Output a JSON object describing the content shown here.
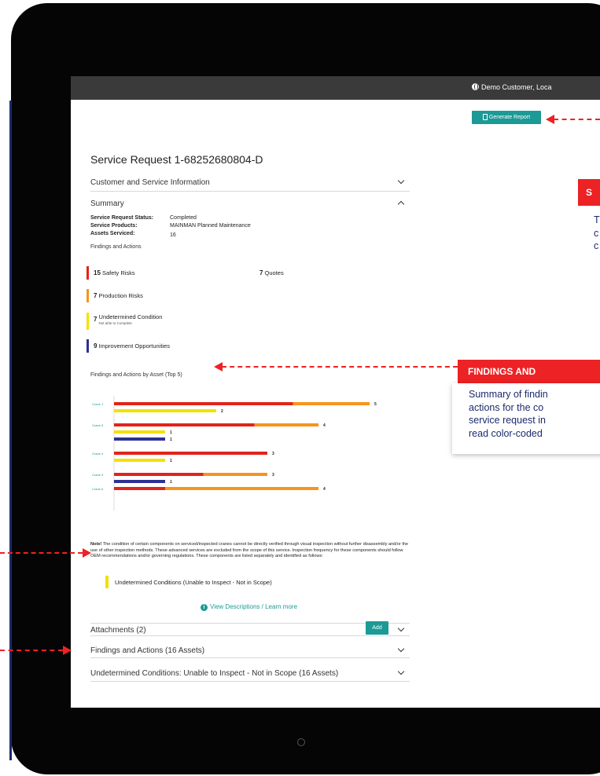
{
  "topbar": {
    "customer": "Demo Customer, Loca"
  },
  "toolbar": {
    "generate_report": "Generate Report"
  },
  "request": {
    "title": "Service Request 1-68252680804-D"
  },
  "sections": {
    "customer_info": "Customer and Service Information",
    "summary": "Summary",
    "attachments": "Attachments (2)",
    "findings": "Findings and Actions (16 Assets)",
    "undetermined": "Undetermined Conditions: Unable to Inspect - Not in Scope (16 Assets)"
  },
  "summary": {
    "status_label": "Service Request Status:",
    "status_value": "Completed",
    "products_label": "Service Products:",
    "products_value": "MAINMAN Planned Maintenance",
    "assets_label": "Assets Serviced:",
    "assets_value": "16",
    "findings_heading": "Findings and Actions",
    "chart_heading": "Findings and Actions by Asset (Top 5)"
  },
  "findings": [
    {
      "count": "15",
      "label": "Safety Risks",
      "color": "#e2231a"
    },
    {
      "count": "7",
      "label": "Production Risks",
      "color": "#f7941d"
    },
    {
      "count": "7",
      "label": "Undetermined Condition",
      "sub": "Not able to Complete",
      "color": "#f5e000"
    },
    {
      "count": "9",
      "label": "Improvement Opportunities",
      "color": "#2e3192"
    }
  ],
  "quotes": {
    "count": "7",
    "label": "Quotes"
  },
  "chart_data": {
    "type": "bar",
    "orientation": "horizontal",
    "categories": [
      "Crane 1",
      "Crane 5",
      "Crane 4",
      "Crane 3",
      "Crane 6"
    ],
    "bars": [
      {
        "category": "Crane 1",
        "segments": [
          {
            "series": "Safety Risks",
            "value": 3.5
          },
          {
            "series": "Production Risks",
            "value": 1.5
          }
        ],
        "total": "5"
      },
      {
        "category": "Crane 1",
        "segments": [
          {
            "series": "Undetermined Condition",
            "value": 2
          }
        ],
        "total": "2"
      },
      {
        "category": "Crane 5",
        "segments": [
          {
            "series": "Safety Risks",
            "value": 2.75
          },
          {
            "series": "Production Risks",
            "value": 1.25
          }
        ],
        "total": "4"
      },
      {
        "category": "Crane 5",
        "segments": [
          {
            "series": "Undetermined Condition",
            "value": 1
          }
        ],
        "total": "1"
      },
      {
        "category": "Crane 5",
        "segments": [
          {
            "series": "Improvement Opportunities",
            "value": 1
          }
        ],
        "total": "1"
      },
      {
        "category": "Crane 4",
        "segments": [
          {
            "series": "Safety Risks",
            "value": 3
          }
        ],
        "total": "3"
      },
      {
        "category": "Crane 4",
        "segments": [
          {
            "series": "Undetermined Condition",
            "value": 1
          }
        ],
        "total": "1"
      },
      {
        "category": "Crane 3",
        "segments": [
          {
            "series": "Safety Risks",
            "value": 1.75
          },
          {
            "series": "Production Risks",
            "value": 1.25
          }
        ],
        "total": "3"
      },
      {
        "category": "Crane 3",
        "segments": [
          {
            "series": "Improvement Opportunities",
            "value": 1
          }
        ],
        "total": "1"
      },
      {
        "category": "Crane 6",
        "segments": [
          {
            "series": "Safety Risks",
            "value": 1
          },
          {
            "series": "Production Risks",
            "value": 3
          }
        ],
        "total": "4"
      }
    ],
    "colors": {
      "Safety Risks": "#e2231a",
      "Production Risks": "#f7941d",
      "Undetermined Condition": "#f5e000",
      "Improvement Opportunities": "#2e3192"
    },
    "xlim": [
      0,
      5
    ]
  },
  "note": {
    "lead": "Note!",
    "text": "The condition of certain components on serviced/inspected cranes cannot be directly verified through visual inspection without further disassembly and/or the use of other inspection methods. These advanced services are excluded from the scope of this service. Inspection frequency for these components should follow OEM recommendations and/or governing regulations. These components are listed separately and identified as follows:"
  },
  "legend": {
    "undetermined": "Undetermined Conditions (Unable to Inspect - Not in Scope)"
  },
  "learn_more": "View Descriptions / Learn more",
  "add_button": "Add",
  "callouts": {
    "top_head": "S",
    "top_body": [
      "T",
      "c",
      "c"
    ],
    "findings_head": "FINDINGS AND",
    "findings_body": [
      "Summary of findin",
      "actions for the co",
      "service request in",
      "read color-coded"
    ]
  },
  "theme": {
    "accent": "#1b9a96",
    "callout_red": "#ed2224",
    "callout_text": "#1c2a6e"
  }
}
